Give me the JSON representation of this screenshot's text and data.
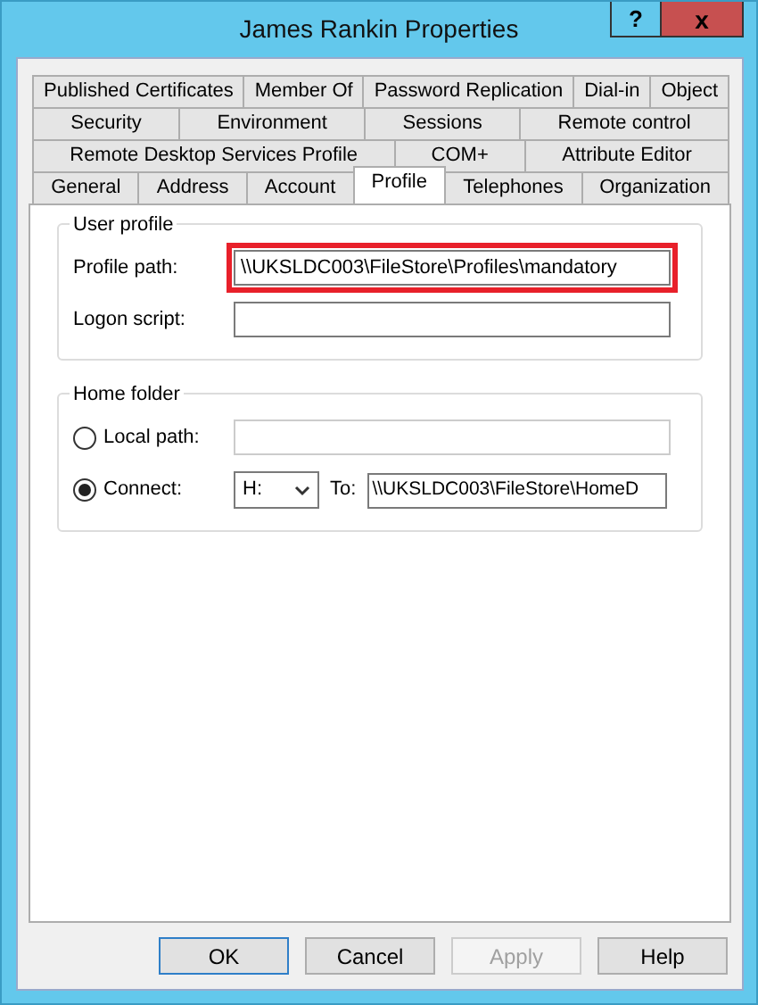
{
  "window": {
    "title": "James Rankin Properties",
    "help_button": "?",
    "close_button": "x"
  },
  "tab_rows": [
    [
      {
        "label": "Published Certificates",
        "selected": false
      },
      {
        "label": "Member Of",
        "selected": false
      },
      {
        "label": "Password Replication",
        "selected": false
      },
      {
        "label": "Dial-in",
        "selected": false
      },
      {
        "label": "Object",
        "selected": false
      }
    ],
    [
      {
        "label": "Security",
        "selected": false
      },
      {
        "label": "Environment",
        "selected": false
      },
      {
        "label": "Sessions",
        "selected": false
      },
      {
        "label": "Remote control",
        "selected": false
      }
    ],
    [
      {
        "label": "Remote Desktop Services Profile",
        "selected": false
      },
      {
        "label": "COM+",
        "selected": false
      },
      {
        "label": "Attribute Editor",
        "selected": false
      }
    ],
    [
      {
        "label": "General",
        "selected": false
      },
      {
        "label": "Address",
        "selected": false
      },
      {
        "label": "Account",
        "selected": false
      },
      {
        "label": "Profile",
        "selected": true
      },
      {
        "label": "Telephones",
        "selected": false
      },
      {
        "label": "Organization",
        "selected": false
      }
    ]
  ],
  "user_profile": {
    "title": "User profile",
    "profile_path": {
      "label": "Profile path:",
      "value": "\\\\UKSLDC003\\FileStore\\Profiles\\mandatory",
      "highlighted": true
    },
    "logon_script": {
      "label": "Logon script:"
    }
  },
  "home_folder": {
    "title": "Home folder",
    "local_path": {
      "label": "Local path:",
      "selected": false,
      "disabled": true
    },
    "connect": {
      "label": "Connect:",
      "selected": true,
      "drive": "H:",
      "to_label": "To:",
      "value": "\\\\UKSLDC003\\FileStore\\HomeD"
    }
  },
  "buttons": [
    {
      "label": "OK",
      "disabled": false,
      "default": true
    },
    {
      "label": "Cancel",
      "disabled": false,
      "default": false
    },
    {
      "label": "Apply",
      "disabled": true,
      "default": false
    },
    {
      "label": "Help",
      "disabled": false,
      "default": false
    }
  ]
}
